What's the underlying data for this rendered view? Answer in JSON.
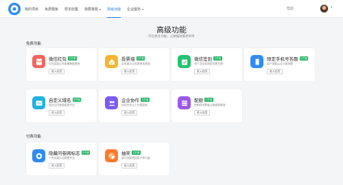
{
  "header": {
    "nav": [
      {
        "label": "我的项目"
      },
      {
        "label": "免费模板"
      },
      {
        "label": "样本收集"
      },
      {
        "label": "我要答题",
        "caret": true
      },
      {
        "label": "高级功能",
        "active": true
      },
      {
        "label": "企业服务",
        "caret": true
      }
    ],
    "help": "帮助",
    "caret": "▾"
  },
  "page": {
    "title": "高级功能",
    "subtitle": "开启更多功能，让数据收集更简单"
  },
  "sections": {
    "free": "免费功能",
    "paid": "付费功能"
  },
  "cards": [
    {
      "name": "微信红包",
      "badge": "已开通",
      "desc": "红包奖励让你收集数据更快",
      "button": "进入应用",
      "color": "#f0665e",
      "icon": "red-packet-icon"
    },
    {
      "name": "投票墙",
      "badge": "已开通",
      "desc": "实时展示让投票更加直观",
      "button": "进入应用",
      "color": "#f4b534",
      "icon": "vote-wall-icon"
    },
    {
      "name": "微信签到",
      "badge": "已开通",
      "desc": "线下活动现场签到更方便",
      "button": "进入应用",
      "color": "#24c36d",
      "icon": "checkin-icon"
    },
    {
      "name": "限定手机号答题",
      "badge": "已开通",
      "desc": "用户需要认证才能答题",
      "button": "进入应用",
      "color": "#2f8cf0",
      "icon": "phone-limit-icon"
    },
    {
      "name": "自定义域名",
      "badge": "已开通",
      "desc": "提交后问卷链接更专业",
      "button": "进入应用",
      "color": "#21b2e0",
      "icon": "custom-domain-icon"
    },
    {
      "name": "企业协作",
      "badge": "已开通",
      "desc": "协同合作让工作更高效",
      "button": "进入应用",
      "color": "#7a5cf0",
      "icon": "team-collab-icon"
    },
    {
      "name": "配额",
      "badge": "已开通",
      "desc": "控制样本数量让数据更精准",
      "button": "进入应用",
      "color": "#9b59e6",
      "icon": "quota-icon"
    },
    {
      "name": "隐藏问卷网标志",
      "badge": "已开通",
      "desc": "个性化展示品牌更专业",
      "button": "进入应用",
      "color": "#2f8cf0",
      "icon": "hide-logo-icon"
    },
    {
      "name": "抽奖",
      "badge": "已开通",
      "desc": "填写抽奖增加用户参与度",
      "button": "进入应用",
      "color": "#ff7a2e",
      "icon": "lottery-icon"
    }
  ]
}
